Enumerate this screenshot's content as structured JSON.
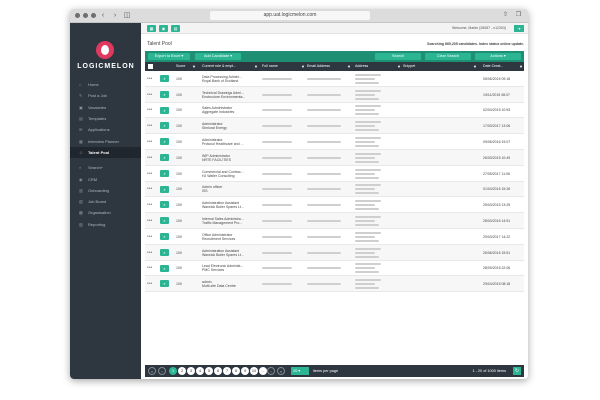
{
  "browser": {
    "url": "app.uat.logicmelon.com"
  },
  "sidebar": {
    "logo_text": "LOGICMELON",
    "items": [
      {
        "label": "Home",
        "icon": "home-icon"
      },
      {
        "label": "Post a Job",
        "icon": "pencil-icon"
      },
      {
        "label": "Vacancies",
        "icon": "briefcase-icon"
      },
      {
        "label": "Templates",
        "icon": "document-icon"
      },
      {
        "label": "Applications",
        "icon": "inbox-icon"
      },
      {
        "label": "Interview Planner",
        "icon": "calendar-icon"
      },
      {
        "label": "Talent Pool",
        "icon": "people-icon",
        "active": true
      },
      {
        "label": "Search+",
        "icon": "search-icon"
      },
      {
        "label": "CRM",
        "icon": "chat-icon"
      },
      {
        "label": "Onboarding",
        "icon": "clipboard-icon"
      },
      {
        "label": "Job Board",
        "icon": "board-icon"
      },
      {
        "label": "Organisation",
        "icon": "building-icon"
      },
      {
        "label": "Reporting",
        "icon": "chart-icon"
      }
    ]
  },
  "header": {
    "welcome": "Welcome, Martin (28087 - n12303)",
    "page_title": "Talent Pool",
    "search_info": "Searching 669,205 candidates. Index status online update."
  },
  "toolbar": {
    "export_label": "Export to Excel ▾",
    "add_candidate_label": "Add Candidate ▾",
    "search_label": "Search",
    "clear_search_label": "Clear Search",
    "actions_label": "Actions ▾"
  },
  "table": {
    "headers": {
      "score": "Score",
      "role": "Current role & empl...",
      "name": "Full name",
      "email": "Email Address",
      "address": "Address",
      "snippet": "Snippet",
      "date": "Date Creat..."
    },
    "rows": [
      {
        "score": "100",
        "role": "Data Processing Admini...",
        "employer": "Royal Bank of Scotland",
        "date": "05/06/2015 09:18"
      },
      {
        "score": "100",
        "role": "Technical Drawings Admi...",
        "employer": "Enstructure Environmenta...",
        "date": "19/11/2015 08:07"
      },
      {
        "score": "100",
        "role": "Sales Administrator",
        "employer": "Aggregate Industries",
        "date": "02/04/2015 10:53"
      },
      {
        "score": "100",
        "role": "Administrator",
        "employer": "Simlurat Energy",
        "date": "17/03/2017 13:06"
      },
      {
        "score": "100",
        "role": "Administrator",
        "employer": "Protocol Healthcare and ...",
        "date": "09/06/2016 19:07"
      },
      {
        "score": "100",
        "role": "WIP Administrator",
        "employer": "NRTE FACILITIES",
        "date": "26/03/2015 10:49"
      },
      {
        "score": "100",
        "role": "Commercial and Contrac...",
        "employer": "HJ Waller Consulting",
        "date": "27/05/2017 11:06"
      },
      {
        "score": "100",
        "role": "Admin officer",
        "employer": "ISS",
        "date": "01/04/2015 15:26"
      },
      {
        "score": "100",
        "role": "Administration Assistant",
        "employer": "Warwick Boiler Spares Lt...",
        "date": "25/03/2015 13:25"
      },
      {
        "score": "100",
        "role": "Internal Sales Administra...",
        "employer": "Traffic Management Pro...",
        "date": "28/03/2015 14:51"
      },
      {
        "score": "100",
        "role": "Office Administrator",
        "employer": "Recruitment Services",
        "date": "29/03/2017 14:22"
      },
      {
        "score": "100",
        "role": "Administration Assistant",
        "employer": "Warwick Boiler Spares Lt...",
        "date": "26/06/2015 15:51"
      },
      {
        "score": "100",
        "role": "Lead Electronic Administ...",
        "employer": "PMC Services",
        "date": "28/09/2015 22:06"
      },
      {
        "score": "100",
        "role": "admin",
        "employer": "Multi-site Data Centre",
        "date": "29/04/2015 08:18"
      }
    ]
  },
  "pager": {
    "pages": [
      "1",
      "2",
      "3",
      "4",
      "5",
      "6",
      "7",
      "8",
      "9",
      "10",
      "..."
    ],
    "per_page": "20",
    "per_page_label": "items per page",
    "range": "1 - 20 of 1000 items"
  },
  "colors": {
    "accent": "#2bb593",
    "sidebar": "#2e3740",
    "brand": "#e0395f"
  }
}
